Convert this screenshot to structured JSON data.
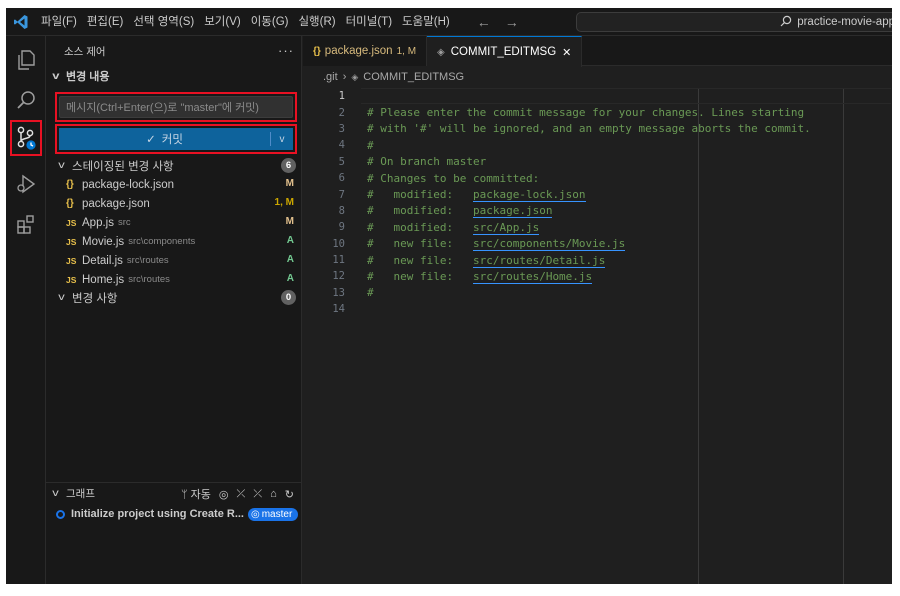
{
  "menu": [
    "파일(F)",
    "편집(E)",
    "선택 영역(S)",
    "보기(V)",
    "이동(G)",
    "실행(R)",
    "터미널(T)",
    "도움말(H)"
  ],
  "nav": {
    "back": "←",
    "forward": "→"
  },
  "search": {
    "text": "practice-movie-app"
  },
  "sidebar": {
    "title": "소스 제어",
    "more": "···",
    "section_label": "변경 내용",
    "message_placeholder": "메시지(Ctrl+Enter(으)로 \"master\"에 커밋)",
    "commit_label": "커밋",
    "staged_label": "스테이징된 변경 사항",
    "staged_count": "6",
    "staged": [
      {
        "icon": "{}",
        "name": "package-lock.json",
        "path": "",
        "status": "M"
      },
      {
        "icon": "{}",
        "name": "package.json",
        "path": "",
        "status": "1, M"
      },
      {
        "icon": "JS",
        "name": "App.js",
        "path": "src",
        "status": "M"
      },
      {
        "icon": "JS",
        "name": "Movie.js",
        "path": "src\\components",
        "status": "A"
      },
      {
        "icon": "JS",
        "name": "Detail.js",
        "path": "src\\routes",
        "status": "A"
      },
      {
        "icon": "JS",
        "name": "Home.js",
        "path": "src\\routes",
        "status": "A"
      }
    ],
    "changes_label": "변경 사항",
    "changes_count": "0"
  },
  "graph": {
    "title": "그래프",
    "auto_label": "자동",
    "commit_message": "Initialize project using Create R...",
    "branch": "master"
  },
  "tabs": [
    {
      "icon": "{}",
      "label": "package.json",
      "badge": "1, M"
    },
    {
      "icon": "◈",
      "label": "COMMIT_EDITMSG",
      "close": "✕"
    }
  ],
  "breadcrumb": {
    "folder": ".git",
    "sep": "›",
    "file": "COMMIT_EDITMSG"
  },
  "code": [
    {
      "n": "1",
      "text": ""
    },
    {
      "n": "2",
      "text": "# Please enter the commit message for your changes. Lines starting"
    },
    {
      "n": "3",
      "text": "# with '#' will be ignored, and an empty message aborts the commit."
    },
    {
      "n": "4",
      "text": "#"
    },
    {
      "n": "5",
      "text": "# On branch master"
    },
    {
      "n": "6",
      "text": "# Changes to be committed:"
    },
    {
      "n": "7",
      "prefix": "#   modified:   ",
      "link": "package-lock.json"
    },
    {
      "n": "8",
      "prefix": "#   modified:   ",
      "link": "package.json"
    },
    {
      "n": "9",
      "prefix": "#   modified:   ",
      "link": "src/App.js"
    },
    {
      "n": "10",
      "prefix": "#   new file:   ",
      "link": "src/components/Movie.js"
    },
    {
      "n": "11",
      "prefix": "#   new file:   ",
      "link": "src/routes/Detail.js"
    },
    {
      "n": "12",
      "prefix": "#   new file:   ",
      "link": "src/routes/Home.js"
    },
    {
      "n": "13",
      "text": "#"
    },
    {
      "n": "14",
      "text": ""
    }
  ],
  "colors": {
    "accent": "#0078d4",
    "commit_button": "#0e639c",
    "highlight_box": "#e81123",
    "modified": "#e2c08d",
    "added": "#73c991",
    "warning": "#cca700",
    "comment": "#6a9955"
  }
}
